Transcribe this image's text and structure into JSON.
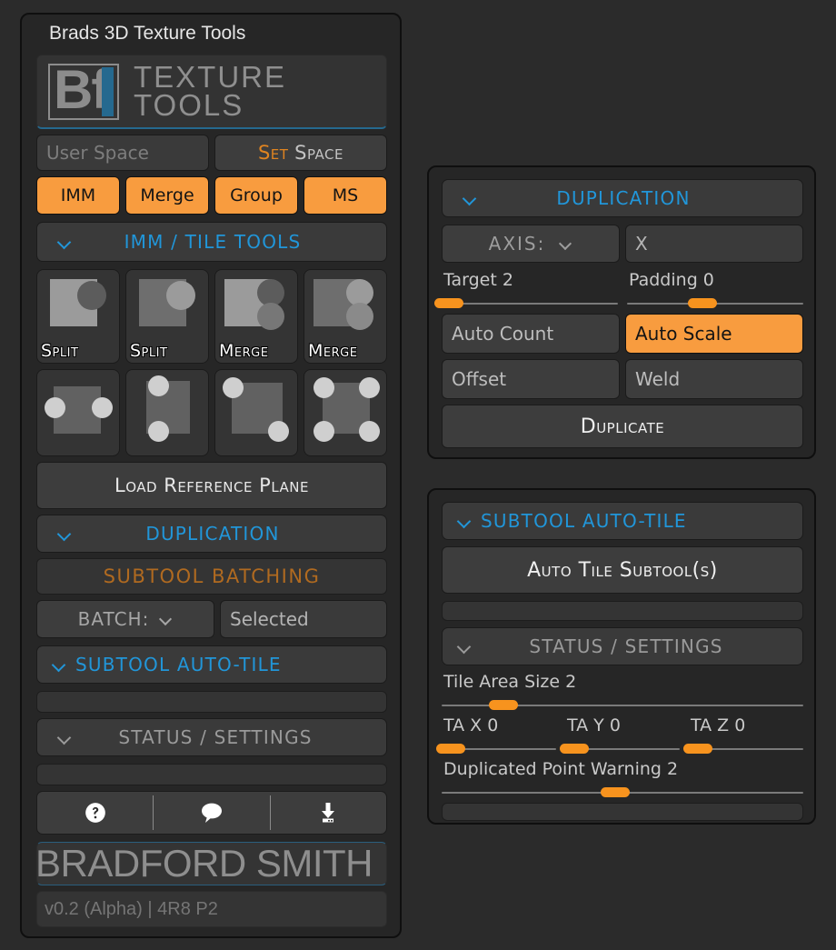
{
  "window": {
    "title": "Brads 3D Texture Tools"
  },
  "colors": {
    "accent_orange": "#f89c3f",
    "accent_blue": "#2196d9",
    "header_blue": "#2196d9",
    "batch_orange": "#b06a20",
    "logo_teal": "#25698f",
    "panel_bg": "#262626",
    "button_bg": "#3d3d3d"
  },
  "logo": {
    "mark_b": "B",
    "mark_f": "f",
    "line1": "TEXTURE",
    "line2": "TOOLS"
  },
  "space": {
    "name": "User Space",
    "set_word1": "Set",
    "set_word2": "Space"
  },
  "tags": [
    {
      "label": "IMM",
      "active": true
    },
    {
      "label": "Merge",
      "active": true
    },
    {
      "label": "Group",
      "active": true
    },
    {
      "label": "MS",
      "active": true
    }
  ],
  "imm_tile_tools": {
    "header": "IMM / TILE TOOLS",
    "row1": [
      {
        "label": "Split",
        "icon": "split-square-circle-dark-icon"
      },
      {
        "label": "Split",
        "icon": "split-square-circle-light-icon"
      },
      {
        "label": "Merge",
        "icon": "merge-square-two-circles-dark-icon"
      },
      {
        "label": "Merge",
        "icon": "merge-square-two-circles-light-icon"
      }
    ],
    "row2": [
      {
        "label": "",
        "icon": "tile-points-horizontal-icon"
      },
      {
        "label": "",
        "icon": "tile-points-vertical-icon"
      },
      {
        "label": "",
        "icon": "tile-points-diagonal-icon"
      },
      {
        "label": "",
        "icon": "tile-points-corners-icon"
      }
    ]
  },
  "load_reference_plane": "Load Reference Plane",
  "left_duplication": {
    "header": "DUPLICATION"
  },
  "subtool_batching": {
    "header": "SUBTOOL BATCHING",
    "batch_label": "BATCH:",
    "batch_value": "Selected"
  },
  "left_auto_tile": {
    "header": "SUBTOOL AUTO-TILE"
  },
  "left_status": {
    "header": "STATUS / SETTINGS"
  },
  "footer_icons": [
    {
      "name": "help-icon",
      "glyph": "?"
    },
    {
      "name": "feedback-icon",
      "glyph": "speech"
    },
    {
      "name": "download-icon",
      "glyph": "download"
    }
  ],
  "credit": {
    "name": "BRADFORD SMITH"
  },
  "version": {
    "text": "v0.2 (Alpha)  |  4R8 P2"
  },
  "duplication": {
    "header": "DUPLICATION",
    "axis_label": "AXIS:",
    "axis_value": "X",
    "sliders": [
      {
        "label": "Target 2",
        "name": "target",
        "value": 2,
        "knob_pct": 4
      },
      {
        "label": "Padding 0",
        "name": "padding",
        "value": 0,
        "knob_pct": 43
      }
    ],
    "toggles": [
      {
        "label": "Auto Count",
        "active": false
      },
      {
        "label": "Auto Scale",
        "active": true
      },
      {
        "label": "Offset",
        "active": false
      },
      {
        "label": "Weld",
        "active": false
      }
    ],
    "duplicate_button": "Duplicate"
  },
  "subtool_auto_tile": {
    "header": "SUBTOOL AUTO-TILE",
    "button": "Auto Tile Subtool(s)"
  },
  "status_settings": {
    "header": "STATUS / SETTINGS",
    "tile_area_size": {
      "label": "Tile Area Size 2",
      "value": 2,
      "knob_pct": 17
    },
    "ta_axes": [
      {
        "label": "TA X 0",
        "value": 0,
        "knob_pct": 6
      },
      {
        "label": "TA Y 0",
        "value": 0,
        "knob_pct": 6
      },
      {
        "label": "TA Z 0",
        "value": 0,
        "knob_pct": 6
      }
    ],
    "duplicated_point_warning": {
      "label": "Duplicated Point Warning 2",
      "value": 2,
      "knob_pct": 48
    }
  }
}
